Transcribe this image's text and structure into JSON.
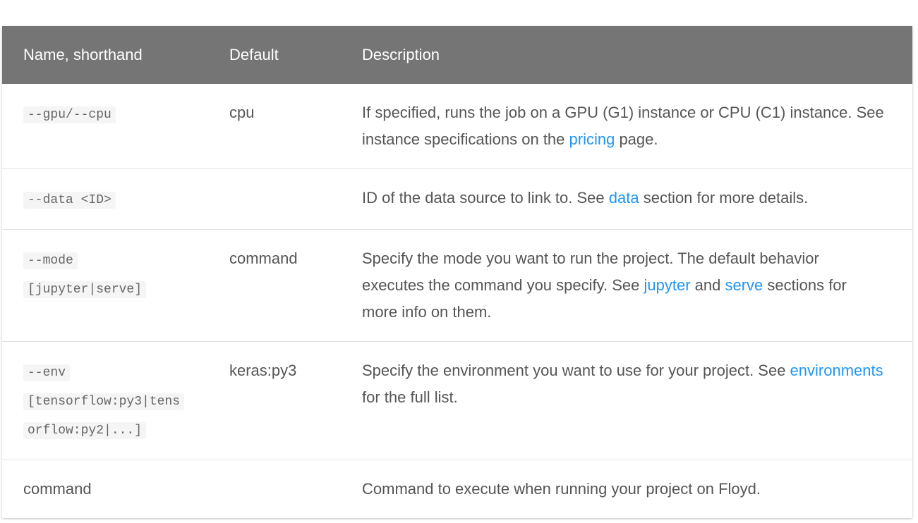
{
  "header": {
    "col1": "Name, shorthand",
    "col2": "Default",
    "col3": "Description"
  },
  "rows": [
    {
      "name": "--gpu/--cpu",
      "default": "cpu",
      "desc_pre": "If specified, runs the job on a GPU (G1) instance or CPU (C1) instance. See instance specifications on the ",
      "link1": "pricing",
      "desc_post": " page."
    },
    {
      "name": "--data <ID>",
      "default": "",
      "desc_pre": "ID of the data source to link to. See ",
      "link1": "data",
      "desc_post": " section for more details."
    },
    {
      "name_line1": "--mode",
      "name_line2": "[jupyter|serve]",
      "default": "command",
      "desc_pre": "Specify the mode you want to run the project. The default behavior executes the command you specify. See ",
      "link1": "jupyter",
      "desc_mid": " and ",
      "link2": "serve",
      "desc_post": " sections for more info on them."
    },
    {
      "name_line1": "--env",
      "name_line2": "[tensorflow:py3|tensorflow:py2|...]",
      "default": "keras:py3",
      "desc_pre": "Specify the environment you want to use for your project. See ",
      "link1": "environments",
      "desc_post": " for the full list."
    },
    {
      "name": "command",
      "default": "",
      "desc": "Command to execute when running your project on Floyd."
    }
  ],
  "colors": {
    "header_bg": "#757575",
    "link": "#2196f3",
    "text": "#555555",
    "code_bg": "#f5f5f5"
  }
}
